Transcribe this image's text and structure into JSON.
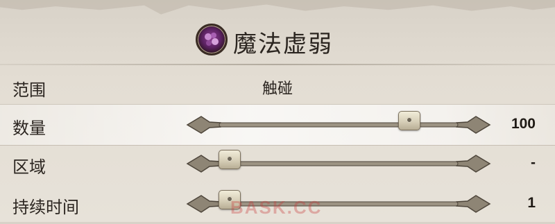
{
  "header": {
    "title": "魔法虚弱",
    "icon": "magic-weakness-icon"
  },
  "rows": [
    {
      "label": "范围",
      "value": "触碰"
    },
    {
      "label": "数量",
      "value": "100",
      "slider_fraction": 0.82
    },
    {
      "label": "区域",
      "value": "-",
      "slider_fraction": 0.0
    },
    {
      "label": "持续时间",
      "value": "1",
      "slider_fraction": 0.0
    }
  ],
  "watermark": "BASK.CC",
  "colors": {
    "highlight": "#ffffff",
    "icon_accent": "#7a3580"
  }
}
